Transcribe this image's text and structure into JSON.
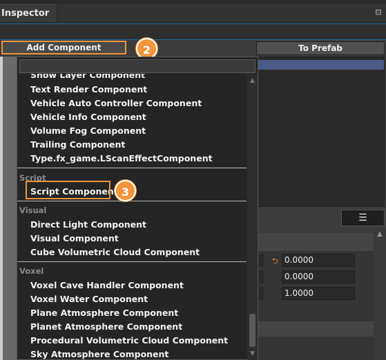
{
  "window": {
    "title": "Inspector"
  },
  "toolbar": {
    "add_component_label": "Add Component",
    "to_prefab_label": "To Prefab"
  },
  "steps": {
    "step2": "2",
    "step3": "3"
  },
  "accent_color": "#f0953a",
  "dropdown": {
    "partial_top_item": "Show Layer Component",
    "items_group_1": [
      "Text Render Component",
      "Vehicle Auto Controller Component",
      "Vehicle Info Component",
      "Volume Fog Component",
      "Trailing Component",
      "Type.fx_game.LScanEffectComponent"
    ],
    "script_category": "Script",
    "script_items": [
      "Script Component"
    ],
    "visual_category": "Visual",
    "visual_items": [
      "Direct Light Component",
      "Visual Component",
      "Cube Volumetric Cloud Component"
    ],
    "voxel_category": "Voxel",
    "voxel_items": [
      "Voxel Cave Handler Component",
      "Voxel Water Component",
      "Plane Atmosphere Component",
      "Planet Atmosphere Component",
      "Procedural Volumetric Cloud Component",
      "Sky Atmosphere Component"
    ]
  },
  "properties": {
    "values": [
      "0.0000",
      "0.0000",
      "1.0000"
    ]
  },
  "icons": {
    "pin": "pin-icon",
    "align": "align-center-icon",
    "reset": "reset-arrow-icon",
    "scroll_up": "chevron-up-icon",
    "scroll_down": "chevron-down-icon"
  }
}
